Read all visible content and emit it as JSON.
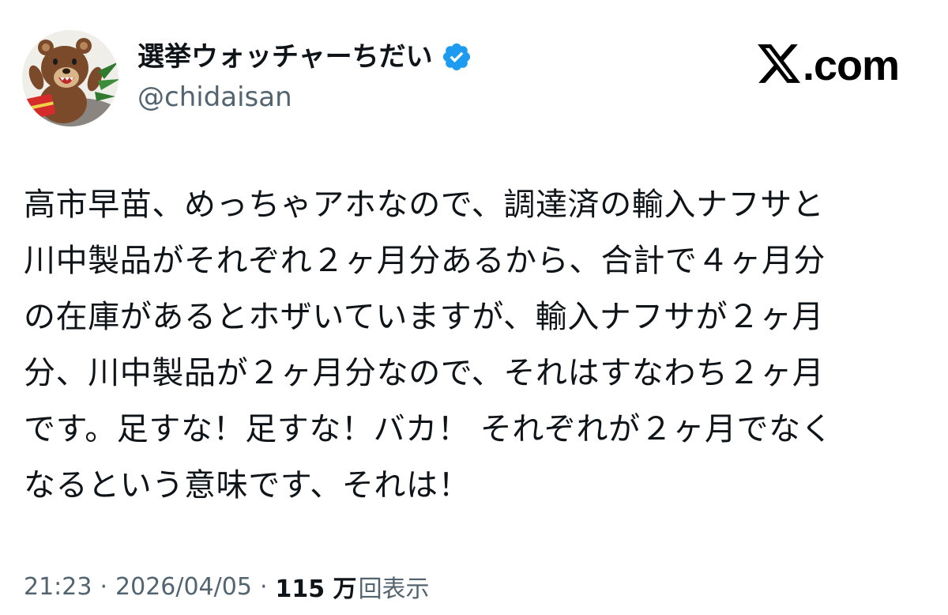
{
  "author": {
    "display_name": "選挙ウォッチャーちだい",
    "handle": "@chidaisan",
    "verified": true,
    "avatar_icon": "bear-avatar-icon"
  },
  "brand": {
    "logo_icon": "x-logo-icon",
    "text": ".com"
  },
  "tweet": {
    "lines": [
      "高市早苗、めっちゃアホなので、調達済の輸入ナフサと",
      "川中製品がそれぞれ２ヶ月分あるから、合計で４ヶ月分",
      "の在庫があるとホザいていますが、輸入ナフサが２ヶ月",
      "分、川中製品が２ヶ月分なので、それはすなわち２ヶ月",
      "です。足すな！足すな！バカ！ それぞれが２ヶ月でなく",
      "なるという意味です、それは！"
    ]
  },
  "meta": {
    "time": "21:23",
    "separator": "·",
    "date": "2026/04/05",
    "views_count": "115 万",
    "views_label": "回表示"
  },
  "colors": {
    "text": "#0f1419",
    "secondary": "#536471",
    "verified_badge": "#1d9bf0"
  }
}
